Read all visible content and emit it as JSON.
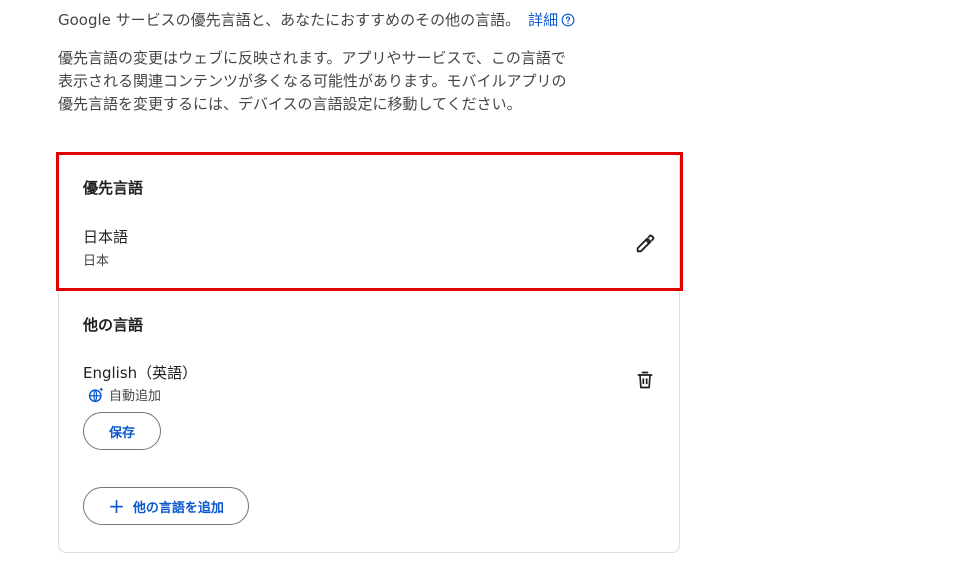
{
  "intro": {
    "text": "Google サービスの優先言語と、あなたにおすすめのその他の言語。",
    "link_label": "詳細"
  },
  "description": {
    "lines": [
      "優先言語の変更はウェブに反映されます。アプリやサービスで、この言語で",
      "表示される関連コンテンツが多くなる可能性があります。モバイルアプリの",
      "優先言語を変更するには、デバイスの言語設定に移動してください。"
    ]
  },
  "preferred": {
    "title": "優先言語",
    "language": "日本語",
    "region": "日本"
  },
  "other": {
    "title": "他の言語",
    "language": "English（英語）",
    "auto_added": "自動追加",
    "save_label": "保存",
    "add_label": "他の言語を追加"
  },
  "colors": {
    "accent": "#0b57d0",
    "highlight": "#e20000",
    "text": "#1f1f1f",
    "secondary": "#444746"
  }
}
